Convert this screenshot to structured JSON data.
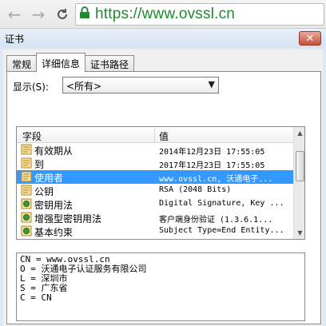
{
  "browser": {
    "back_icon": "back-arrow-icon",
    "forward_icon": "forward-arrow-icon",
    "reload_icon": "reload-icon",
    "lock_icon": "lock-icon",
    "url": "https://www.ovssl.cn",
    "url_color": "#1e8b2e"
  },
  "dialog": {
    "title": "证书",
    "close_label": "✕",
    "tabs": [
      {
        "label": "常规",
        "active": false
      },
      {
        "label": "详细信息",
        "active": true
      },
      {
        "label": "证书路径",
        "active": false
      }
    ],
    "show_label": "显示(S):",
    "show_value": "<所有>",
    "columns": {
      "field": "字段",
      "value": "值"
    },
    "rows": [
      {
        "field": "有效期从",
        "value": "2014年12月23日 17:55:05",
        "icon": "cert-field-icon",
        "selected": false
      },
      {
        "field": "到",
        "value": "2017年12月23日 17:55:05",
        "icon": "cert-field-icon",
        "selected": false
      },
      {
        "field": "使用者",
        "value": "www.ovssl.cn, 沃通电子...",
        "icon": "cert-field-icon",
        "selected": true
      },
      {
        "field": "公钥",
        "value": "RSA (2048 Bits)",
        "icon": "cert-field-icon",
        "selected": false
      },
      {
        "field": "密钥用法",
        "value": "Digital Signature, Key ...",
        "icon": "cert-extension-icon",
        "selected": false
      },
      {
        "field": "增强型密钥用法",
        "value": "客户端身份验证 (1.3.6.1...",
        "icon": "cert-extension-icon",
        "selected": false
      },
      {
        "field": "基本约束",
        "value": "Subject Type=End Entity...",
        "icon": "cert-extension-icon",
        "selected": false
      }
    ],
    "detail_lines": [
      "CN = www.ovssl.cn",
      "O = 沃通电子认证服务有限公司",
      "L = 深圳市",
      "S = 广东省",
      "C = CN"
    ],
    "selection_color": "#3399ff"
  }
}
